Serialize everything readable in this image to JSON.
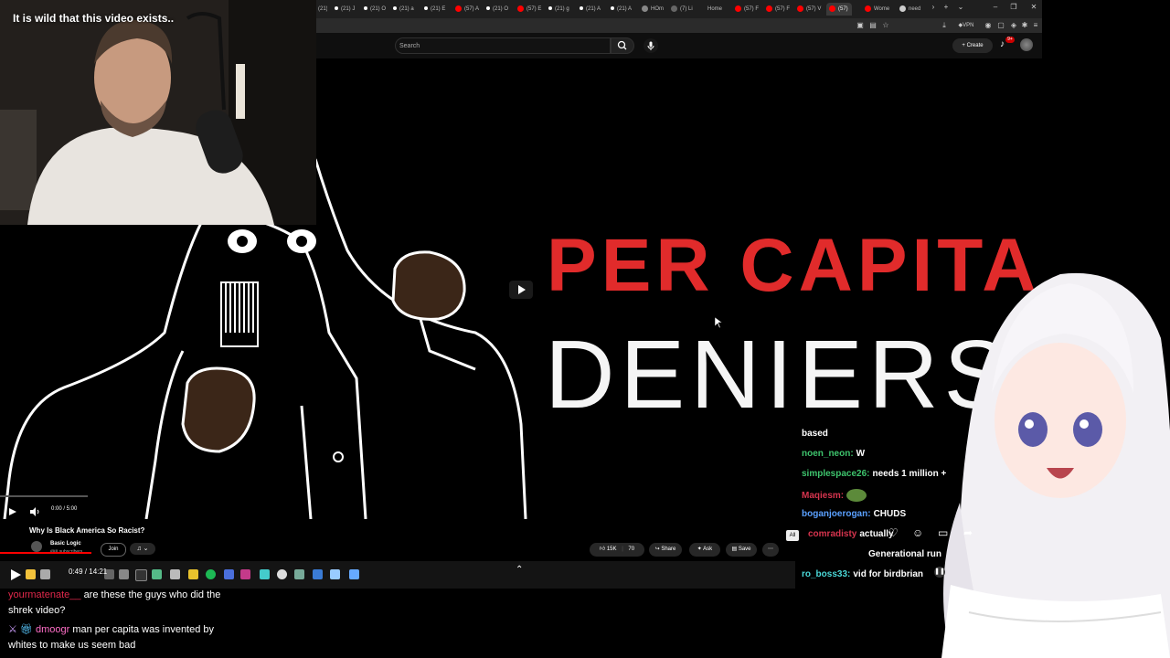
{
  "webcam": {
    "caption": "It is wild that this video exists.."
  },
  "browser": {
    "tabs": [
      "(21) J",
      "(21) O",
      "(21) a",
      "(21) E",
      "(57) A",
      "(21) O",
      "(57) E",
      "(21) g",
      "(21) A",
      "(21) A",
      "HOm",
      "(7) Li",
      "Home",
      "(57) F",
      "(57) F",
      "(57) V",
      "(57)",
      "Wome",
      "need"
    ],
    "vpn_label": "VPN",
    "colors": {
      "tabbar": "#1f1f1f",
      "toolbar": "#2b2b2b"
    }
  },
  "youtube": {
    "search_placeholder": "Search",
    "create_label": "Create",
    "notif_count": "9+"
  },
  "video": {
    "title_line1": "PER CAPITA",
    "title_line2": "DENIERS",
    "time_display": "0:00 / 5:00",
    "accent": "#e12b2b"
  },
  "info": {
    "video_title": "Why Is Black America So Racist?",
    "channel_name": "Basic Logic",
    "subscribers": "### subscribers",
    "join_label": "Join",
    "likes": "15K",
    "dislikes": "70",
    "share_label": "Share",
    "ask_label": "Ask",
    "save_label": "Save",
    "progress_fraction": 0.0
  },
  "media_player": {
    "time": "0:49 / 14:21"
  },
  "bottom_chat": [
    {
      "user": "yourmatenate__",
      "message": "are these the guys who did the shrek video?",
      "user_color": "#e0284b"
    },
    {
      "user": "dmoogr",
      "message": "man per capita was invented by whites to make us seem bad",
      "user_color": "#ff6ec7"
    }
  ],
  "stream_chat": [
    {
      "user": "",
      "message": "based",
      "user_color": "#ffffff"
    },
    {
      "user": "noen_neon:",
      "message": "W",
      "user_color": "#3ec46d"
    },
    {
      "user": "simplespace26:",
      "message": "needs 1 million +",
      "user_color": "#3ec46d"
    },
    {
      "user": "Maqiesm:",
      "message": "",
      "user_color": "#d6344e"
    },
    {
      "user": "boganjoerogan:",
      "message": "CHUDS",
      "user_color": "#5aa0ff"
    },
    {
      "user": "comradisty",
      "message": "actually",
      "user_color": "#d6344e"
    },
    {
      "user": "",
      "message": "Generational run",
      "user_color": "#ffffff"
    },
    {
      "user": "ro_boss33:",
      "message": "vid for birdbrian",
      "user_color": "#4ad8d8"
    }
  ],
  "chat_filter_label": "All"
}
